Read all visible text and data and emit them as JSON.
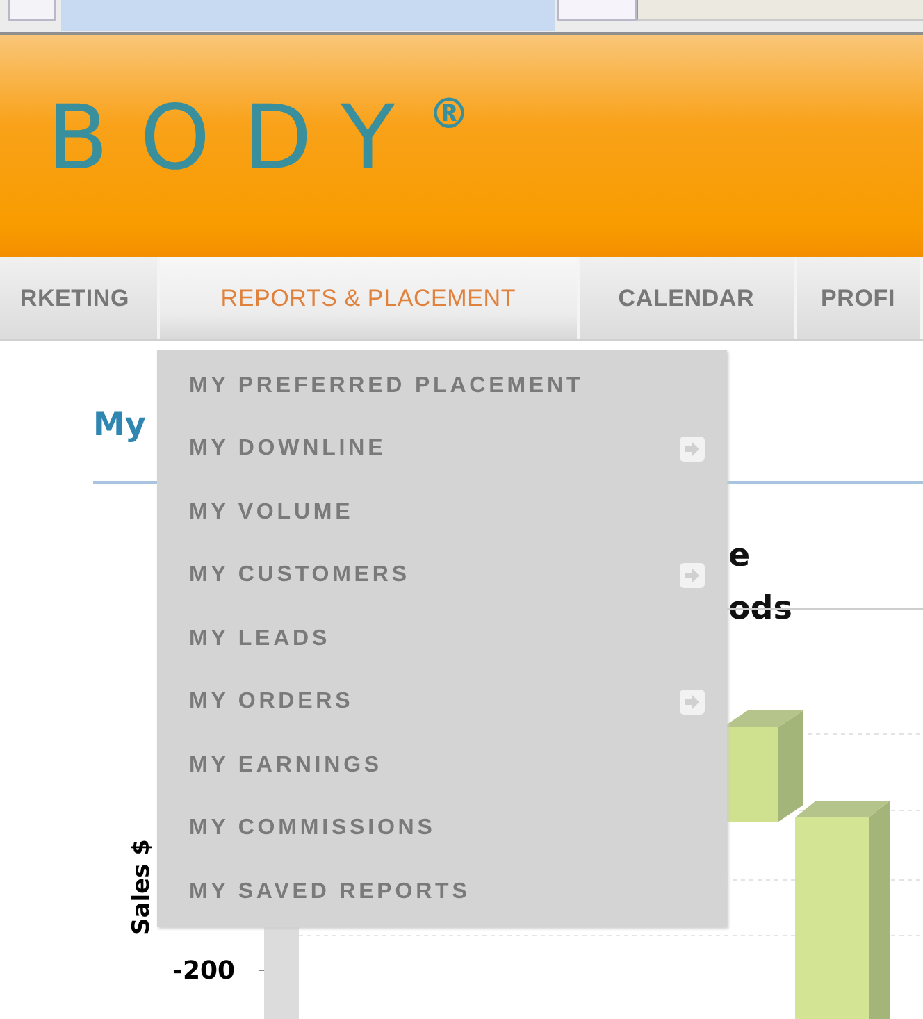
{
  "logo": {
    "text": "BODY",
    "mark": "®"
  },
  "nav": {
    "tabs": [
      {
        "label": "RKETING",
        "selected": false
      },
      {
        "label": "REPORTS & PLACEMENT",
        "selected": true
      },
      {
        "label": "CALENDAR",
        "selected": false
      },
      {
        "label": "PROFI",
        "selected": false
      }
    ]
  },
  "page": {
    "heading": "My"
  },
  "chart": {
    "title_lines": [
      "e",
      "ods"
    ],
    "ylabel": "Sales $",
    "ytick": "-200"
  },
  "dropdown": {
    "items": [
      {
        "label": "MY PREFERRED PLACEMENT",
        "submenu": false
      },
      {
        "label": "MY DOWNLINE",
        "submenu": true
      },
      {
        "label": "MY VOLUME",
        "submenu": false
      },
      {
        "label": "MY CUSTOMERS",
        "submenu": true
      },
      {
        "label": "MY LEADS",
        "submenu": false
      },
      {
        "label": "MY ORDERS",
        "submenu": true
      },
      {
        "label": "MY EARNINGS",
        "submenu": false
      },
      {
        "label": "MY COMMISSIONS",
        "submenu": false
      },
      {
        "label": "MY SAVED REPORTS",
        "submenu": false
      }
    ]
  }
}
